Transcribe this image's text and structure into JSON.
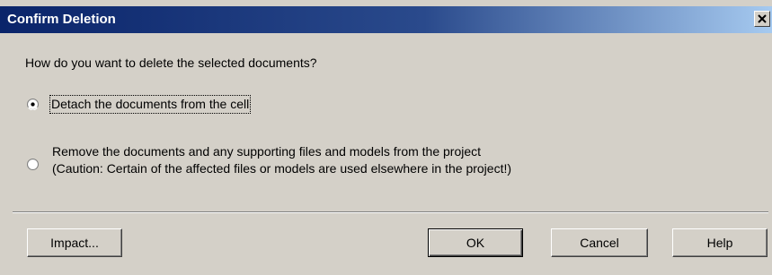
{
  "window": {
    "title": "Confirm Deletion",
    "close_label": "X"
  },
  "prompt": "How do you want to delete the selected documents?",
  "options": [
    {
      "label": "Detach the documents from the cell",
      "selected": true
    },
    {
      "line1": "Remove the documents and any supporting files and models from the project",
      "line2": "(Caution: Certain of the affected files or models are used elsewhere in the project!)",
      "selected": false
    }
  ],
  "buttons": {
    "impact": "Impact...",
    "ok": "OK",
    "cancel": "Cancel",
    "help": "Help"
  },
  "colors": {
    "title_bar_start": "#0a246a",
    "title_bar_end": "#a6caf0",
    "dialog_face": "#d4d0c8"
  }
}
